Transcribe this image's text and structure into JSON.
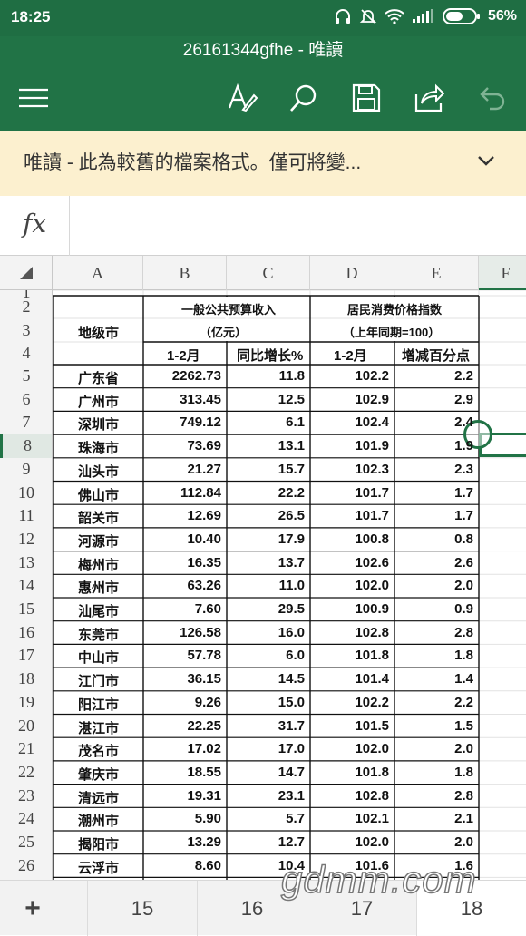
{
  "status_bar": {
    "time": "18:25",
    "battery": "56%"
  },
  "title": "26161344gfhe - 唯讀",
  "notice": {
    "text": "唯讀 - 此為較舊的檔案格式。僅可將變..."
  },
  "formula_bar": {
    "label": "fx",
    "value": ""
  },
  "columns": [
    "A",
    "B",
    "C",
    "D",
    "E",
    "F"
  ],
  "row_numbers": [
    "1",
    "2",
    "3",
    "4",
    "5",
    "6",
    "7",
    "8",
    "9",
    "10",
    "11",
    "12",
    "13",
    "14",
    "15",
    "16",
    "17",
    "18",
    "19",
    "20",
    "21",
    "22",
    "23",
    "24",
    "25",
    "26"
  ],
  "selected_row": "8",
  "table": {
    "region_header": "地级市",
    "budget_group": "一般公共预算收入",
    "budget_unit": "（亿元）",
    "cpi_group": "居民消费价格指数",
    "cpi_note": "（上年同期=100）",
    "sub_headers": [
      "1-2月",
      "同比增长%",
      "1-2月",
      "增减百分点"
    ],
    "rows": [
      [
        "广东省",
        "2262.73",
        "11.8",
        "102.2",
        "2.2"
      ],
      [
        "广州市",
        "313.45",
        "12.5",
        "102.9",
        "2.9"
      ],
      [
        "深圳市",
        "749.12",
        "6.1",
        "102.4",
        "2.4"
      ],
      [
        "珠海市",
        "73.69",
        "13.1",
        "101.9",
        "1.9"
      ],
      [
        "汕头市",
        "21.27",
        "15.7",
        "102.3",
        "2.3"
      ],
      [
        "佛山市",
        "112.84",
        "22.2",
        "101.7",
        "1.7"
      ],
      [
        "韶关市",
        "12.69",
        "26.5",
        "101.7",
        "1.7"
      ],
      [
        "河源市",
        "10.40",
        "17.9",
        "100.8",
        "0.8"
      ],
      [
        "梅州市",
        "16.35",
        "13.7",
        "102.6",
        "2.6"
      ],
      [
        "惠州市",
        "63.26",
        "11.0",
        "102.0",
        "2.0"
      ],
      [
        "汕尾市",
        "7.60",
        "29.5",
        "100.9",
        "0.9"
      ],
      [
        "东莞市",
        "126.58",
        "16.0",
        "102.8",
        "2.8"
      ],
      [
        "中山市",
        "57.78",
        "6.0",
        "101.8",
        "1.8"
      ],
      [
        "江门市",
        "36.15",
        "14.5",
        "101.4",
        "1.4"
      ],
      [
        "阳江市",
        "9.26",
        "15.0",
        "102.2",
        "2.2"
      ],
      [
        "湛江市",
        "22.25",
        "31.7",
        "101.5",
        "1.5"
      ],
      [
        "茂名市",
        "17.02",
        "17.0",
        "102.0",
        "2.0"
      ],
      [
        "肇庆市",
        "18.55",
        "14.7",
        "101.8",
        "1.8"
      ],
      [
        "清远市",
        "19.31",
        "23.1",
        "102.8",
        "2.8"
      ],
      [
        "潮州市",
        "5.90",
        "5.7",
        "102.1",
        "2.1"
      ],
      [
        "揭阳市",
        "13.29",
        "12.7",
        "102.0",
        "2.0"
      ],
      [
        "云浮市",
        "8.60",
        "10.4",
        "101.6",
        "1.6"
      ]
    ]
  },
  "sheet_tabs": {
    "add": "+",
    "tabs": [
      "15",
      "16",
      "17",
      "18"
    ],
    "active": "18"
  },
  "watermark": "gdmm.com",
  "colors": {
    "brand": "#217346",
    "notice_bg": "#fcf0cf",
    "selection": "#217346"
  },
  "icons": [
    "menu-icon",
    "pen-icon",
    "search-icon",
    "save-icon",
    "share-icon",
    "undo-icon",
    "chevron-down-icon"
  ]
}
